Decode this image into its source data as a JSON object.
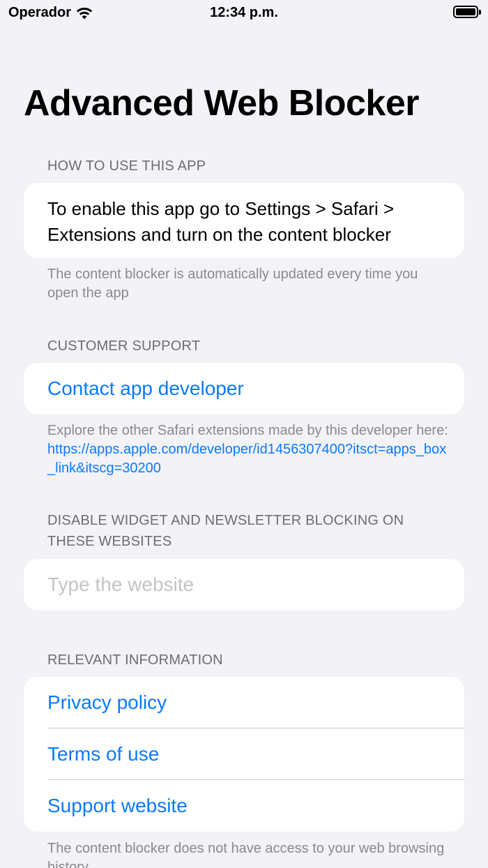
{
  "status_bar": {
    "carrier": "Operador",
    "time": "12:34 p.m.",
    "wifi_icon": "wifi-icon",
    "battery_icon": "battery-full-icon"
  },
  "title": "Advanced Web Blocker",
  "how_to": {
    "header": "HOW TO USE THIS APP",
    "body": "To enable this app go to Settings > Safari > Extensions and turn on the content blocker",
    "footer": "The content blocker is automatically updated every time you open the app"
  },
  "support": {
    "header": "CUSTOMER SUPPORT",
    "contact_label": "Contact app developer",
    "footer_prefix": "Explore the other Safari extensions made by this developer here: ",
    "footer_link": "https://apps.apple.com/developer/id1456307400?itsct=apps_box_link&itscg=30200"
  },
  "whitelist": {
    "header": "DISABLE WIDGET AND NEWSLETTER BLOCKING ON THESE WEBSITES",
    "placeholder": "Type the website",
    "value": ""
  },
  "info": {
    "header": "RELEVANT INFORMATION",
    "items": [
      {
        "label": "Privacy policy"
      },
      {
        "label": "Terms of use"
      },
      {
        "label": "Support website"
      }
    ],
    "footer": "The content blocker does not have access to your web browsing history"
  },
  "colors": {
    "accent": "#0a7aff",
    "background": "#f2f2f7",
    "card": "#ffffff",
    "secondary_text": "#6d6d72"
  }
}
